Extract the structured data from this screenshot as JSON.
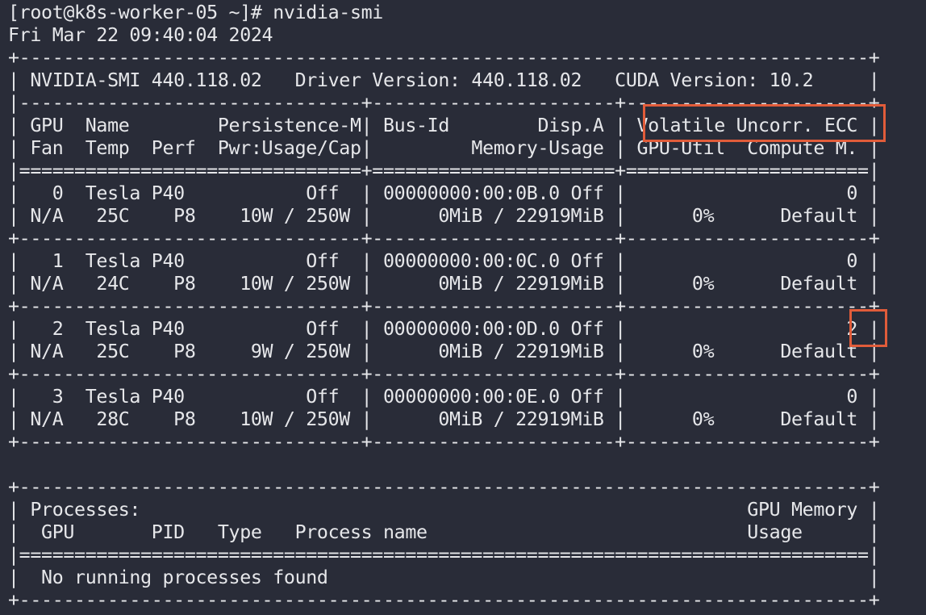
{
  "terminal": {
    "prompt": "[root@k8s-worker-05 ~]# nvidia-smi",
    "timestamp": "Fri Mar 22 09:40:04 2024",
    "smi_header": {
      "version_line": "| NVIDIA-SMI 440.118.02   Driver Version: 440.118.02   CUDA Version: 10.2     |"
    },
    "table_lines": [
      "+-----------------------------------------------------------------------------+",
      "|-------------------------------+----------------------+----------------------+",
      "| GPU  Name        Persistence-M| Bus-Id        Disp.A | Volatile Uncorr. ECC |",
      "| Fan  Temp  Perf  Pwr:Usage/Cap|         Memory-Usage | GPU-Util  Compute M. |",
      "|===============================+======================+======================|",
      "|   0  Tesla P40           Off  | 00000000:00:0B.0 Off |                    0 |",
      "| N/A   25C    P8    10W / 250W |      0MiB / 22919MiB |      0%      Default |",
      "+-------------------------------+----------------------+----------------------+",
      "|   1  Tesla P40           Off  | 00000000:00:0C.0 Off |                    0 |",
      "| N/A   24C    P8    10W / 250W |      0MiB / 22919MiB |      0%      Default |",
      "+-------------------------------+----------------------+----------------------+",
      "|   2  Tesla P40           Off  | 00000000:00:0D.0 Off |                    2 |",
      "| N/A   25C    P8     9W / 250W |      0MiB / 22919MiB |      0%      Default |",
      "+-------------------------------+----------------------+----------------------+",
      "|   3  Tesla P40           Off  | 00000000:00:0E.0 Off |                    0 |",
      "| N/A   28C    P8    10W / 250W |      0MiB / 22919MiB |      0%      Default |",
      "+-------------------------------+----------------------+----------------------+"
    ],
    "processes_lines": [
      "+-----------------------------------------------------------------------------+",
      "| Processes:                                                       GPU Memory |",
      "|  GPU       PID   Type   Process name                             Usage      |",
      "|=============================================================================|",
      "|  No running processes found                                                 |",
      "+-----------------------------------------------------------------------------+"
    ]
  },
  "colors": {
    "background": "#292c38",
    "text": "#e6e7ea",
    "highlight": "#e15c3a"
  }
}
